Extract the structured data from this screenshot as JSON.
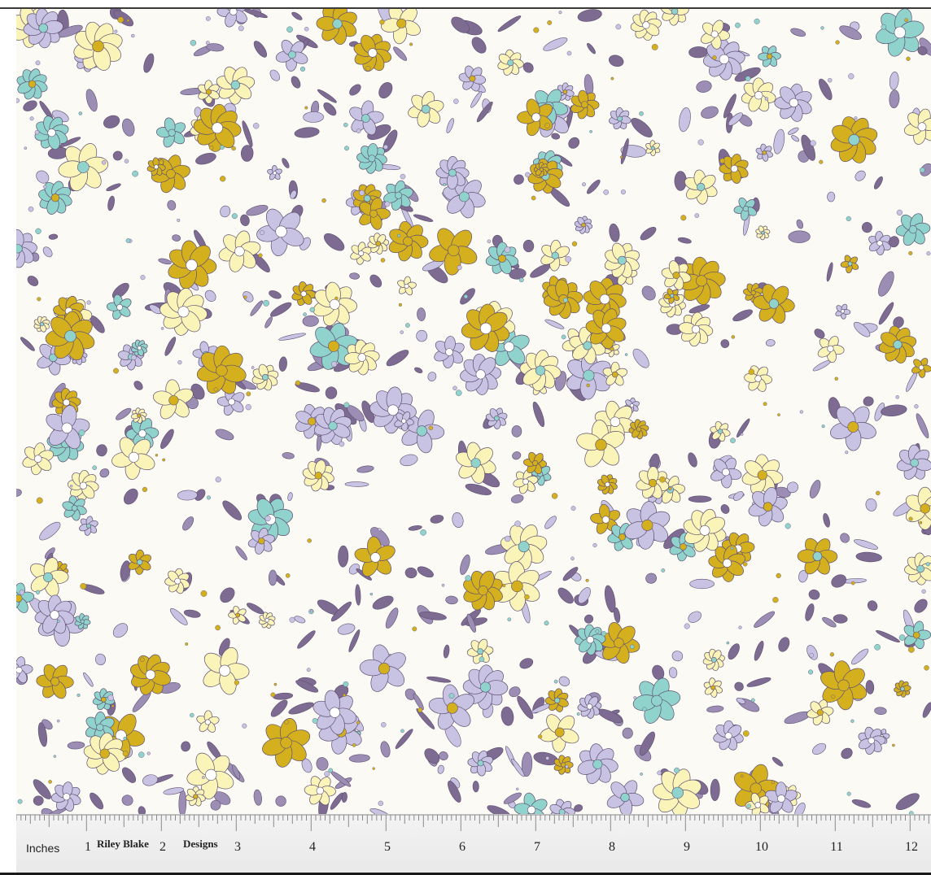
{
  "image": {
    "subject": "floral print fabric swatch",
    "palette": {
      "background": "#fbfaf4",
      "purple_dark": "#7d6b92",
      "purple_mid": "#9c8db4",
      "lavender": "#c9c3e3",
      "mustard": "#d4b01e",
      "butter": "#faf4b8",
      "aqua": "#8fd3cc",
      "outline": "#5d4f70"
    }
  },
  "ruler": {
    "unit_label": "Inches",
    "brand_part1": "Riley Blake",
    "brand_part2": "Designs",
    "marks": [
      "1",
      "2",
      "3",
      "4",
      "5",
      "6",
      "7",
      "8",
      "9",
      "10",
      "11",
      "12"
    ]
  }
}
